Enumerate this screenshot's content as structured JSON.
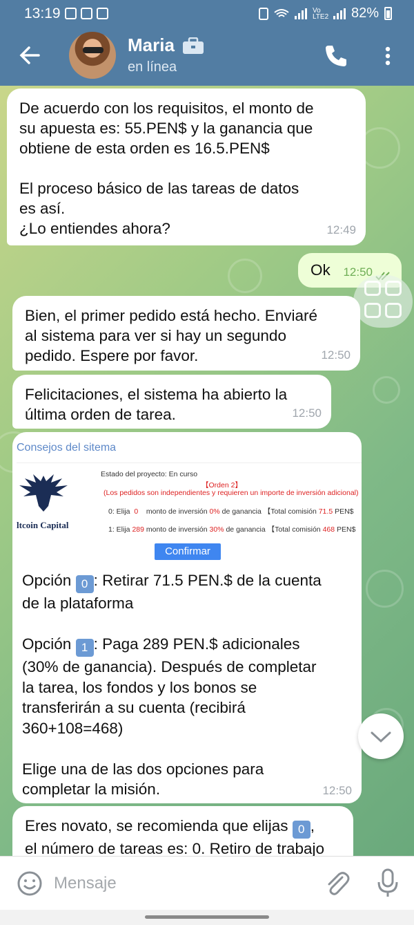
{
  "status_bar": {
    "time": "13:19",
    "battery": "82%",
    "network": "Vo LTE2"
  },
  "header": {
    "name": "Maria",
    "status": "en línea"
  },
  "messages": [
    {
      "direction": "in",
      "text": "De acuerdo con los requisitos, el monto de\nsu apuesta es: 55.PEN$ y la ganancia que\nobtiene de esta orden es 16.5.PEN$\n\nEl proceso básico de las tareas de datos\nes así.\n¿Lo entiendes ahora?",
      "time": "12:49"
    },
    {
      "direction": "out",
      "text": "Ok",
      "time": "12:50"
    },
    {
      "direction": "in",
      "text": "Bien, el primer pedido está hecho. Enviaré\nal sistema para ver si hay un segundo\npedido. Espere por favor.",
      "time": "12:50"
    },
    {
      "direction": "in",
      "text": "Felicitaciones, el sistema ha abierto la\núltima orden de tarea.",
      "time": "12:50"
    }
  ],
  "card": {
    "title": "Consejos del sitema",
    "logo_text": "ltcoin Capital",
    "project_status": "Estado del proyecto: En curso",
    "order": "【Orden 2】",
    "note": "(Los pedidos son independientes y requieren un importe de inversión adicional)",
    "row0": {
      "prefix": "0: Elija",
      "amount": "0",
      "mid": "monto de inversión",
      "pct": "0%",
      "gain": "de ganancia 【Total comisión",
      "total": "71.5",
      "cur": "PEN$"
    },
    "row1": {
      "prefix": "1: Elija",
      "amount": "289",
      "mid": "monto de inversión",
      "pct": "30%",
      "gain": "de ganancia 【Total comisión",
      "total": "468",
      "cur": "PEN$"
    },
    "confirm_label": "Confirmar",
    "opt0_label": "Opción",
    "opt0_key": "0",
    "opt0_text": ": Retirar 71.5 PEN.$ de la cuenta\nde la plataforma",
    "opt1_label": "Opción",
    "opt1_key": "1",
    "opt1_text": ": Paga 289 PEN.$ adicionales\n(30% de ganancia). Después de completar\nla tarea, los fondos y los bonos se\ntransferirán a su cuenta (recibirá\n360+108=468)",
    "closing": "Elige una de las dos opciones para\ncompletar la misión.",
    "time": "12:50"
  },
  "partial_message": {
    "line1": "Eres novato, se recomienda que elijas",
    "key": "0",
    "line1_end": ",",
    "line2": "el número de tareas es: 0. Retiro de trabajo"
  },
  "input": {
    "placeholder": "Mensaje"
  },
  "colors": {
    "header": "#527da3",
    "outgoing": "#eefed7",
    "accent": "#3f86f0"
  }
}
